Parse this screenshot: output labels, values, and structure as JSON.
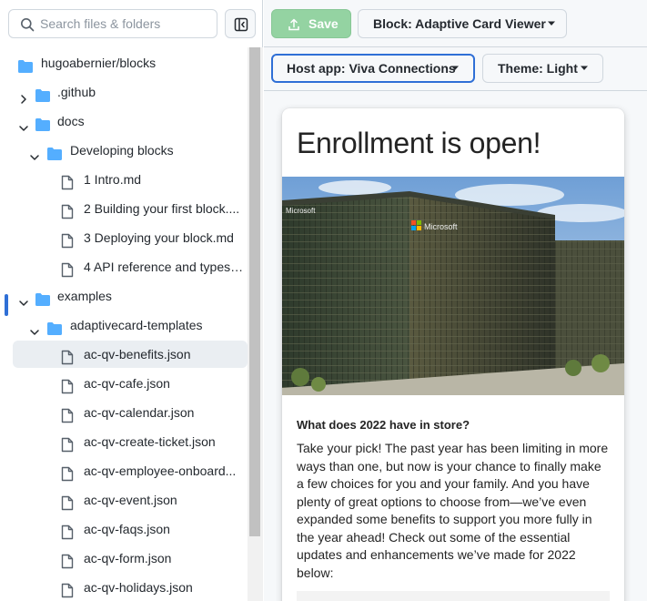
{
  "sidebar": {
    "search": {
      "placeholder": "Search files & folders",
      "value": ""
    },
    "tree": [
      {
        "label": "hugoabernier/blocks",
        "kind": "folder",
        "depth": 0,
        "expanded": null
      },
      {
        "label": ".github",
        "kind": "folder",
        "depth": 1,
        "expanded": false
      },
      {
        "label": "docs",
        "kind": "folder",
        "depth": 1,
        "expanded": true
      },
      {
        "label": "Developing blocks",
        "kind": "folder",
        "depth": 2,
        "expanded": true
      },
      {
        "label": "1 Intro.md",
        "kind": "file",
        "depth": 3
      },
      {
        "label": "2 Building your first block....",
        "kind": "file",
        "depth": 3
      },
      {
        "label": "3 Deploying your block.md",
        "kind": "file",
        "depth": 3
      },
      {
        "label": "4 API reference and types....",
        "kind": "file",
        "depth": 3
      },
      {
        "label": "examples",
        "kind": "folder",
        "depth": 1,
        "expanded": true
      },
      {
        "label": "adaptivecard-templates",
        "kind": "folder",
        "depth": 2,
        "expanded": true
      },
      {
        "label": "ac-qv-benefits.json",
        "kind": "file",
        "depth": 3,
        "selected": true
      },
      {
        "label": "ac-qv-cafe.json",
        "kind": "file",
        "depth": 3
      },
      {
        "label": "ac-qv-calendar.json",
        "kind": "file",
        "depth": 3
      },
      {
        "label": "ac-qv-create-ticket.json",
        "kind": "file",
        "depth": 3
      },
      {
        "label": "ac-qv-employee-onboard...",
        "kind": "file",
        "depth": 3
      },
      {
        "label": "ac-qv-event.json",
        "kind": "file",
        "depth": 3
      },
      {
        "label": "ac-qv-faqs.json",
        "kind": "file",
        "depth": 3
      },
      {
        "label": "ac-qv-form.json",
        "kind": "file",
        "depth": 3
      },
      {
        "label": "ac-qv-holidays.json",
        "kind": "file",
        "depth": 3
      }
    ]
  },
  "toolbar": {
    "save_label": "Save",
    "block_label": "Block: Adaptive Card Viewer",
    "host_label": "Host app: Viva Connections",
    "theme_label": "Theme: Light"
  },
  "card": {
    "title": "Enrollment is open!",
    "image_alt": "Microsoft office building",
    "subtitle": "What does 2022 have in store?",
    "body": "Take your pick! The past year has been limiting in more ways than one, but now is your chance to finally make a few choices for you and your family. And you have plenty of great options to choose from—we’ve even expanded some benefits to support you more fully in the year ahead! Check out some of the essential updates and enhancements we’ve made for 2022 below:",
    "building_sign": "Microsoft"
  },
  "colors": {
    "accent": "#2f6fd6",
    "folder": "#54aeff",
    "save_bg": "#94d3a2"
  }
}
